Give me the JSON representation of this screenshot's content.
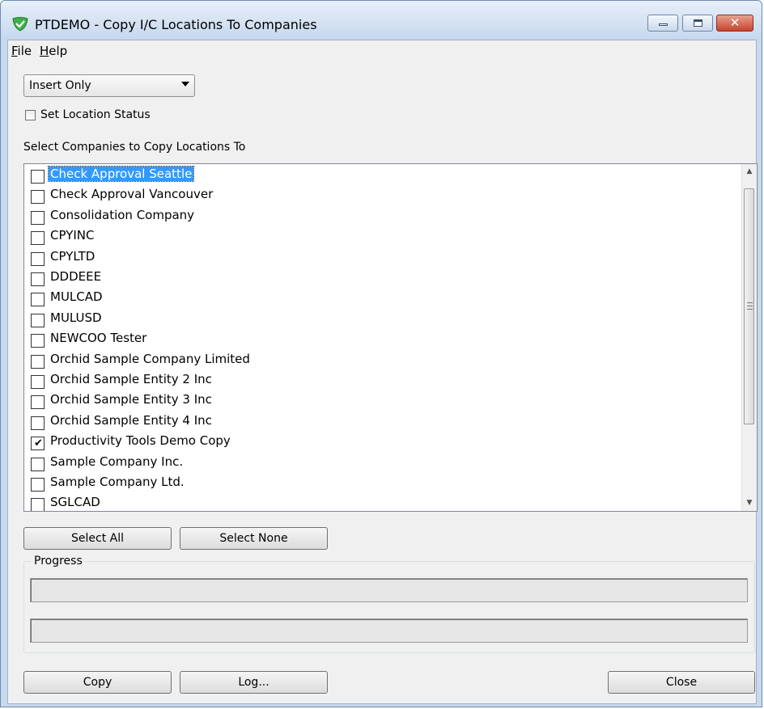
{
  "window": {
    "title": "PTDEMO - Copy I/C Locations To Companies",
    "app_icon": "shield-check-icon",
    "controls": {
      "minimize": "minimize-icon",
      "maximize": "maximize-icon",
      "close": "✕"
    }
  },
  "menu": {
    "file": "File",
    "help": "Help"
  },
  "mode_select": {
    "value": "Insert Only"
  },
  "set_location_status": {
    "label": "Set Location Status",
    "checked": false
  },
  "companies": {
    "label": "Select Companies to Copy Locations To",
    "items": [
      {
        "name": "Check Approval Seattle",
        "checked": false,
        "selected": true
      },
      {
        "name": "Check Approval Vancouver",
        "checked": false,
        "selected": false
      },
      {
        "name": "Consolidation Company",
        "checked": false,
        "selected": false
      },
      {
        "name": "CPYINC",
        "checked": false,
        "selected": false
      },
      {
        "name": "CPYLTD",
        "checked": false,
        "selected": false
      },
      {
        "name": "DDDEEE",
        "checked": false,
        "selected": false
      },
      {
        "name": "MULCAD",
        "checked": false,
        "selected": false
      },
      {
        "name": "MULUSD",
        "checked": false,
        "selected": false
      },
      {
        "name": "NEWCOO Tester",
        "checked": false,
        "selected": false
      },
      {
        "name": "Orchid Sample Company Limited",
        "checked": false,
        "selected": false
      },
      {
        "name": "Orchid Sample Entity 2 Inc",
        "checked": false,
        "selected": false
      },
      {
        "name": "Orchid Sample Entity 3 Inc",
        "checked": false,
        "selected": false
      },
      {
        "name": "Orchid Sample Entity 4 Inc",
        "checked": false,
        "selected": false
      },
      {
        "name": "Productivity Tools Demo Copy",
        "checked": true,
        "selected": false
      },
      {
        "name": "Sample Company Inc.",
        "checked": false,
        "selected": false
      },
      {
        "name": "Sample Company Ltd.",
        "checked": false,
        "selected": false
      },
      {
        "name": "SGLCAD",
        "checked": false,
        "selected": false
      }
    ],
    "scroll": {
      "up_glyph": "▲",
      "down_glyph": "▼"
    }
  },
  "buttons": {
    "select_all": "Select All",
    "select_none": "Select None",
    "copy": "Copy",
    "log": "Log...",
    "close": "Close"
  },
  "progress": {
    "label": "Progress",
    "bar1": 0,
    "bar2": 0
  }
}
